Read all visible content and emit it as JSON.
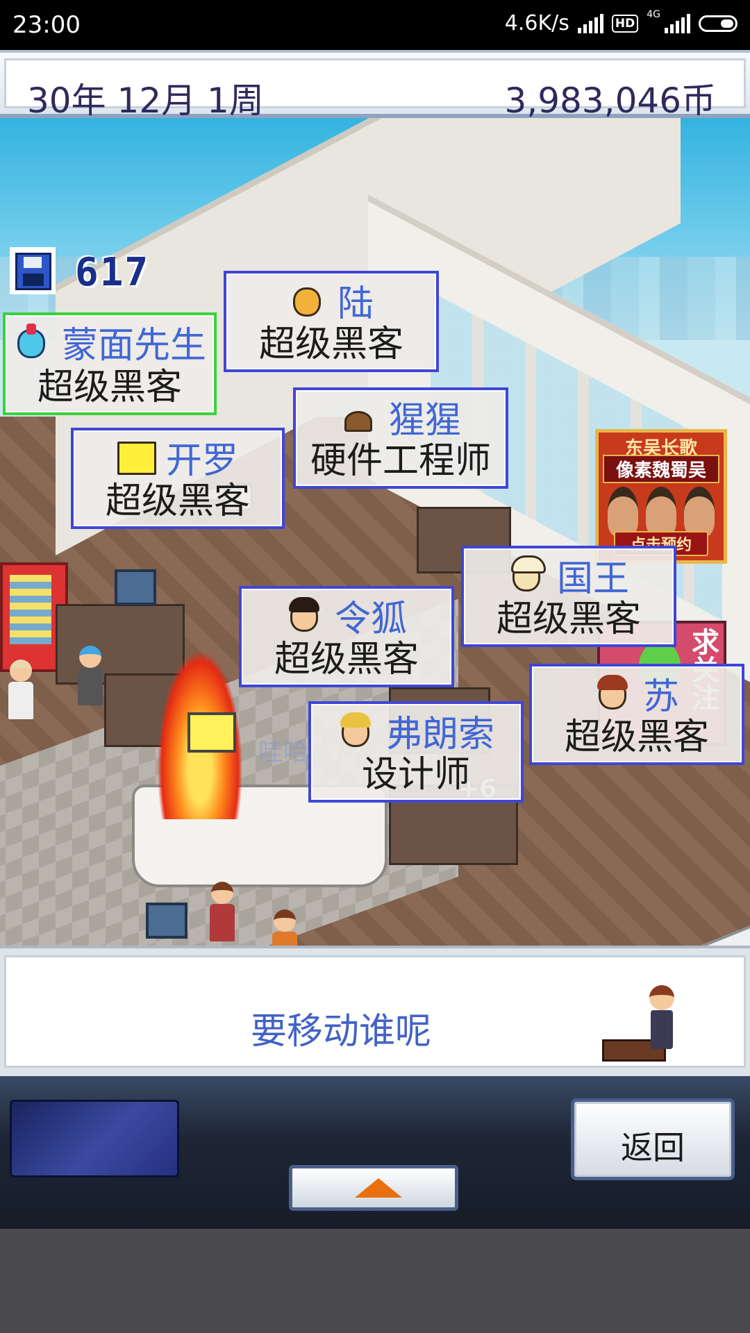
{
  "status_bar": {
    "time": "23:00",
    "net_speed": "4.6K/s",
    "hd_badge": "HD",
    "net_type": "4G",
    "icons": [
      "signal-icon",
      "hd-icon",
      "signal-icon",
      "battery-icon"
    ]
  },
  "header": {
    "date": "30年 12月 1周",
    "money": "3,983,046币"
  },
  "save": {
    "icon": "floppy-disk-icon",
    "count": "617"
  },
  "ad": {
    "title": "东吴长歌",
    "subtitle": "像素魏蜀吴",
    "button": "点击预约"
  },
  "poster": {
    "text": "求关注"
  },
  "scene": {
    "ghost_text": "哇哈哈，感觉不错哦",
    "plus_badge": "+6"
  },
  "employees": [
    {
      "name": "蒙面先生",
      "role": "超级黑客",
      "avatar": "masked-wrestler-avatar",
      "selected": true
    },
    {
      "name": "陆",
      "role": "超级黑客",
      "avatar": "tiger-avatar",
      "selected": false
    },
    {
      "name": "猩猩",
      "role": "硬件工程师",
      "avatar": "gorilla-avatar",
      "selected": false
    },
    {
      "name": "开罗",
      "role": "超级黑客",
      "avatar": "yellow-box-avatar",
      "selected": false
    },
    {
      "name": "国王",
      "role": "超级黑客",
      "avatar": "king-avatar",
      "selected": false
    },
    {
      "name": "令狐",
      "role": "超级黑客",
      "avatar": "dark-hair-avatar",
      "selected": false
    },
    {
      "name": "苏",
      "role": "超级黑客",
      "avatar": "girl-avatar",
      "selected": false
    },
    {
      "name": "弗朗索",
      "role": "设计师",
      "avatar": "blonde-avatar",
      "selected": false
    }
  ],
  "message": {
    "text": "要移动谁呢"
  },
  "controls": {
    "back_label": "返回",
    "up_icon": "up-arrow-icon"
  },
  "colors": {
    "card_border": "#3f46d6",
    "selected_border": "#3ad13a",
    "name_text": "#4167d4",
    "header_text": "#2e2a5c",
    "up_arrow": "#e8700e"
  }
}
